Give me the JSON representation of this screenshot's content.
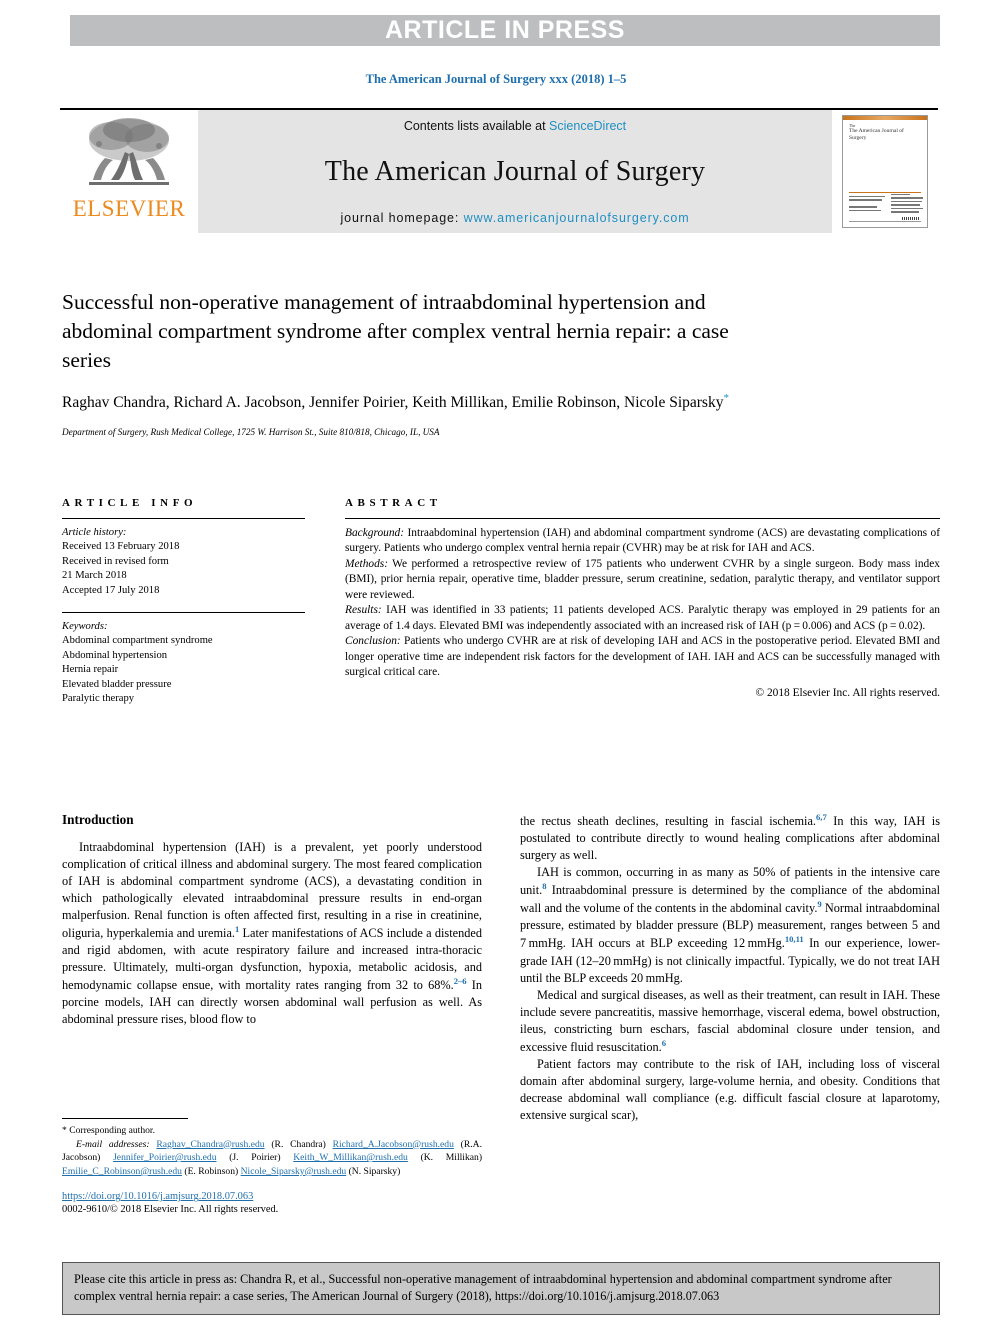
{
  "banner": {
    "text": "ARTICLE IN PRESS",
    "bg_color": "#bdbec0",
    "text_color": "#ffffff"
  },
  "journal_citation": "The American Journal of Surgery xxx (2018) 1–5",
  "masthead": {
    "publisher": "ELSEVIER",
    "contents_prefix": "Contents lists available at ",
    "contents_link": "ScienceDirect",
    "journal_name": "The American Journal of Surgery",
    "homepage_prefix": "journal homepage: ",
    "homepage_url": "www.americanjournalofsurgery.com",
    "cover_title": "The American Journal of Surgery",
    "link_color": "#1f8fc4",
    "publisher_color": "#eb8a1e"
  },
  "article": {
    "title": "Successful non-operative management of intraabdominal hypertension and abdominal compartment syndrome after complex ventral hernia repair: a case series",
    "authors": "Raghav Chandra, Richard A. Jacobson, Jennifer Poirier, Keith Millikan, Emilie Robinson, Nicole Siparsky",
    "corresponding_marker": "*",
    "affiliation": "Department of Surgery, Rush Medical College, 1725 W. Harrison St., Suite 810/818, Chicago, IL, USA"
  },
  "article_info": {
    "heading": "ARTICLE INFO",
    "history_label": "Article history:",
    "history": [
      "Received 13 February 2018",
      "Received in revised form",
      "21 March 2018",
      "Accepted 17 July 2018"
    ],
    "keywords_label": "Keywords:",
    "keywords": [
      "Abdominal compartment syndrome",
      "Abdominal hypertension",
      "Hernia repair",
      "Elevated bladder pressure",
      "Paralytic therapy"
    ]
  },
  "abstract": {
    "heading": "ABSTRACT",
    "sections": [
      {
        "label": "Background:",
        "text": " Intraabdominal hypertension (IAH) and abdominal compartment syndrome (ACS) are devastating complications of surgery. Patients who undergo complex ventral hernia repair (CVHR) may be at risk for IAH and ACS."
      },
      {
        "label": "Methods:",
        "text": " We performed a retrospective review of 175 patients who underwent CVHR by a single surgeon. Body mass index (BMI), prior hernia repair, operative time, bladder pressure, serum creatinine, sedation, paralytic therapy, and ventilator support were reviewed."
      },
      {
        "label": "Results:",
        "text": " IAH was identified in 33 patients; 11 patients developed ACS. Paralytic therapy was employed in 29 patients for an average of 1.4 days. Elevated BMI was independently associated with an increased risk of IAH (p = 0.006) and ACS (p = 0.02)."
      },
      {
        "label": "Conclusion:",
        "text": " Patients who undergo CVHR are at risk of developing IAH and ACS in the postoperative period. Elevated BMI and longer operative time are independent risk factors for the development of IAH. IAH and ACS can be successfully managed with surgical critical care."
      }
    ],
    "copyright": "© 2018 Elsevier Inc. All rights reserved."
  },
  "body": {
    "intro_heading": "Introduction",
    "left_paragraphs": [
      "Intraabdominal hypertension (IAH) is a prevalent, yet poorly understood complication of critical illness and abdominal surgery. The most feared complication of IAH is abdominal compartment syndrome (ACS), a devastating condition in which pathologically elevated intraabdominal pressure results in end-organ malperfusion. Renal function is often affected first, resulting in a rise in creatinine, oliguria, hyperkalemia and uremia.",
      " Later manifestations of ACS include a distended and rigid abdomen, with acute respiratory failure and increased intra-thoracic pressure. Ultimately, multi-organ dysfunction, hypoxia, metabolic acidosis, and hemodynamic collapse ensue, with mortality rates ranging from 32 to 68%.",
      " In porcine models, IAH can directly worsen abdominal wall perfusion as well. As abdominal pressure rises, blood flow to"
    ],
    "left_refs": [
      "1",
      "2–6"
    ],
    "right_paragraphs": [
      {
        "indent": false,
        "runs": [
          {
            "t": "the rectus sheath declines, resulting in fascial ischemia."
          },
          {
            "ref": "6,7"
          },
          {
            "t": " In this way, IAH is postulated to contribute directly to wound healing complications after abdominal surgery as well."
          }
        ]
      },
      {
        "indent": true,
        "runs": [
          {
            "t": "IAH is common, occurring in as many as 50% of patients in the intensive care unit."
          },
          {
            "ref": "8"
          },
          {
            "t": " Intraabdominal pressure is determined by the compliance of the abdominal wall and the volume of the contents in the abdominal cavity."
          },
          {
            "ref": "9"
          },
          {
            "t": " Normal intraabdominal pressure, estimated by bladder pressure (BLP) measurement, ranges between 5 and 7 mmHg. IAH occurs at BLP exceeding 12 mmHg."
          },
          {
            "ref": "10,11"
          },
          {
            "t": " In our experience, lower-grade IAH (12–20 mmHg) is not clinically impactful. Typically, we do not treat IAH until the BLP exceeds 20 mmHg."
          }
        ]
      },
      {
        "indent": true,
        "runs": [
          {
            "t": "Medical and surgical diseases, as well as their treatment, can result in IAH. These include severe pancreatitis, massive hemorrhage, visceral edema, bowel obstruction, ileus, constricting burn eschars, fascial abdominal closure under tension, and excessive fluid resuscitation."
          },
          {
            "ref": "6"
          }
        ]
      },
      {
        "indent": true,
        "runs": [
          {
            "t": "Patient factors may contribute to the risk of IAH, including loss of visceral domain after abdominal surgery, large-volume hernia, and obesity. Conditions that decrease abdominal wall compliance (e.g. difficult fascial closure at laparotomy, extensive surgical scar),"
          }
        ]
      }
    ]
  },
  "footnote": {
    "corresponding": "* Corresponding author.",
    "email_label": "E-mail addresses:",
    "emails": [
      {
        "address": "Raghav_Chandra@rush.edu",
        "person": "(R. Chandra)"
      },
      {
        "address": "Richard_A.Jacobson@rush.edu",
        "person": "(R.A. Jacobson)"
      },
      {
        "address": "Jennifer_Poirier@rush.edu",
        "person": "(J. Poirier)"
      },
      {
        "address": "Keith_W_Millikan@rush.edu",
        "person": "(K. Millikan)"
      },
      {
        "address": "Emilie_C_Robinson@rush.edu",
        "person": "(E. Robinson)"
      },
      {
        "address": "Nicole_Siparsky@rush.edu",
        "person": "(N. Siparsky)"
      }
    ],
    "doi": "https://doi.org/10.1016/j.amjsurg.2018.07.063",
    "issn_copyright": "0002-9610/© 2018 Elsevier Inc. All rights reserved."
  },
  "cite_box": {
    "text": "Please cite this article in press as: Chandra R, et al., Successful non-operative management of intraabdominal hypertension and abdominal compartment syndrome after complex ventral hernia repair: a case series, The American Journal of Surgery (2018), https://doi.org/10.1016/j.amjsurg.2018.07.063",
    "bg_color": "#c8c8c8"
  }
}
